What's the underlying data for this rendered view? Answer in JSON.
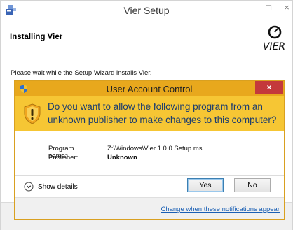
{
  "setup": {
    "title": "Vier Setup",
    "heading": "Installing Vier",
    "status": "Please wait while the Setup Wizard installs Vier.",
    "window_buttons": {
      "minimize": "–",
      "maximize": "□",
      "close": "×"
    }
  },
  "uac": {
    "title": "User Account Control",
    "close": "×",
    "question": "Do you want to allow the following program from an unknown publisher to make changes to this computer?",
    "program_name_label": "Program name:",
    "program_name_value": "Z:\\Windows\\Vier 1.0.0 Setup.msi",
    "publisher_label": "Publisher:",
    "publisher_value": "Unknown",
    "show_details": "Show details",
    "yes": "Yes",
    "no": "No",
    "change_link": "Change when these notifications appear"
  },
  "colors": {
    "uac_frame": "#e8a81d",
    "uac_banner": "#f6c634",
    "question_text": "#1c3d6e",
    "close_button": "#c4393b",
    "link": "#1a5fb4"
  },
  "icons": {
    "setup_app": "installer-icon",
    "vier_logo": "vier-logo",
    "uac_small": "shield-icon",
    "uac_big": "warning-shield-icon",
    "details": "chevron-down-icon"
  }
}
